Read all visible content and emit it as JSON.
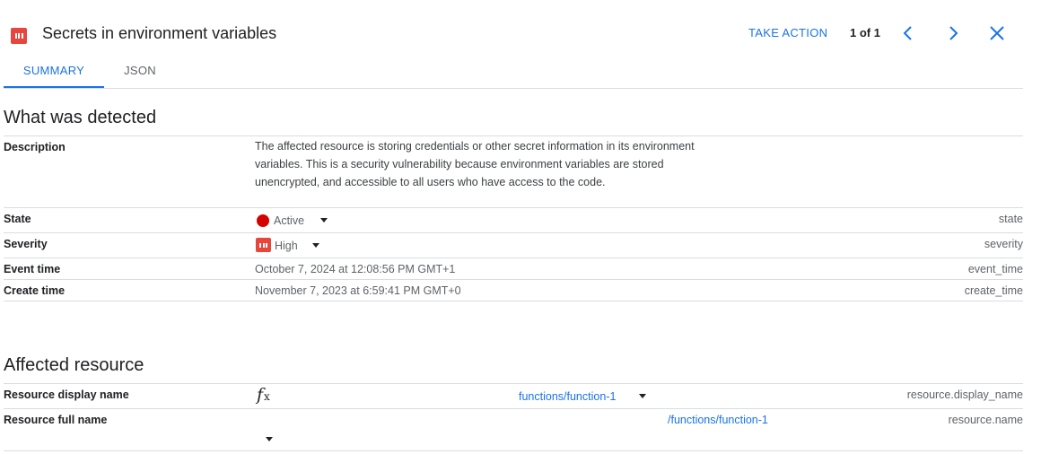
{
  "header": {
    "title": "Secrets in environment variables",
    "take_action": "TAKE ACTION",
    "page_count": "1 of 1",
    "icons": {
      "severity": "severity-high-icon",
      "prev": "chevron-left-icon",
      "next": "chevron-right-icon",
      "close": "close-icon"
    }
  },
  "tabs": [
    {
      "label": "SUMMARY",
      "active": true
    },
    {
      "label": "JSON",
      "active": false
    }
  ],
  "detected": {
    "heading": "What was detected",
    "description": {
      "label": "Description",
      "value": "The affected resource is storing credentials or other secret information in its environment variables. This is a security vulnerability because environment variables are stored unencrypted, and accessible to all users who have access to the code."
    },
    "state": {
      "label": "State",
      "value": "Active",
      "key": "state",
      "color": "#d50000"
    },
    "severity": {
      "label": "Severity",
      "value": "High",
      "key": "severity",
      "color": "#e8453c"
    },
    "event_time": {
      "label": "Event time",
      "value": "October 7, 2024 at 12:08:56 PM GMT+1",
      "key": "event_time"
    },
    "create_time": {
      "label": "Create time",
      "value": "November 7, 2023 at 6:59:41 PM GMT+0",
      "key": "create_time"
    }
  },
  "resource": {
    "heading": "Affected resource",
    "display_name": {
      "label": "Resource display name",
      "icon": "cloud-function-fx-icon",
      "icon_text": "fx",
      "value": "functions/function-1",
      "key": "resource.display_name"
    },
    "full_name": {
      "label": "Resource full name",
      "value": "/functions/function-1",
      "key": "resource.name"
    }
  },
  "colors": {
    "accent": "#1a73e8",
    "danger": "#e8453c",
    "divider": "#dadce0"
  }
}
